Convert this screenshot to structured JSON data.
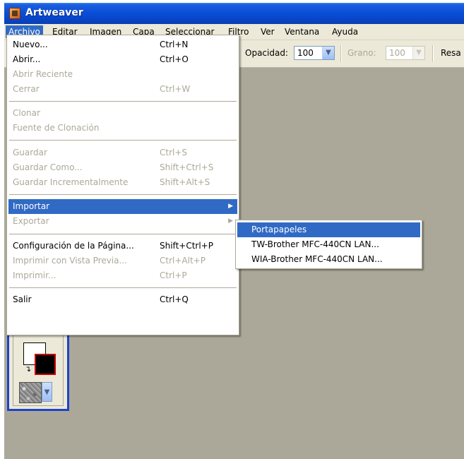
{
  "window": {
    "title": "Artweaver"
  },
  "menubar": [
    {
      "label": "Archivo",
      "active": true
    },
    {
      "label": "Editar"
    },
    {
      "label": "Imagen"
    },
    {
      "label": "Capa"
    },
    {
      "label": "Seleccionar"
    },
    {
      "label": "Filtro"
    },
    {
      "label": "Ver"
    },
    {
      "label": "Ventana"
    },
    {
      "label": "Ayuda"
    }
  ],
  "toolbar": {
    "opacity_label": "Opacidad:",
    "opacity_value": "100",
    "grain_label": "Grano:",
    "grain_value": "100",
    "resa_label": "Resa"
  },
  "archivo_menu": [
    {
      "label": "Nuevo...",
      "shortcut": "Ctrl+N",
      "enabled": true
    },
    {
      "label": "Abrir...",
      "shortcut": "Ctrl+O",
      "enabled": true
    },
    {
      "label": "Abrir Reciente",
      "shortcut": "",
      "enabled": false
    },
    {
      "label": "Cerrar",
      "shortcut": "Ctrl+W",
      "enabled": false
    },
    {
      "label": "Clonar",
      "shortcut": "",
      "enabled": false
    },
    {
      "label": "Fuente de Clonación",
      "shortcut": "",
      "enabled": false
    },
    {
      "label": "Guardar",
      "shortcut": "Ctrl+S",
      "enabled": false
    },
    {
      "label": "Guardar Como...",
      "shortcut": "Shift+Ctrl+S",
      "enabled": false
    },
    {
      "label": "Guardar Incrementalmente",
      "shortcut": "Shift+Alt+S",
      "enabled": false
    },
    {
      "label": "Importar",
      "shortcut": "",
      "enabled": true,
      "submenu": true,
      "highlighted": true
    },
    {
      "label": "Exportar",
      "shortcut": "",
      "enabled": false,
      "submenu": true
    },
    {
      "label": "Configuración de la Página...",
      "shortcut": "Shift+Ctrl+P",
      "enabled": true
    },
    {
      "label": "Imprimir con Vista Previa...",
      "shortcut": "Ctrl+Alt+P",
      "enabled": false
    },
    {
      "label": "Imprimir...",
      "shortcut": "Ctrl+P",
      "enabled": false
    },
    {
      "label": "Salir",
      "shortcut": "Ctrl+Q",
      "enabled": true
    }
  ],
  "importar_submenu": [
    {
      "label": "Portapapeles",
      "highlighted": true
    },
    {
      "label": "TW-Brother MFC-440CN LAN..."
    },
    {
      "label": "WIA-Brother MFC-440CN LAN..."
    }
  ],
  "tool_panel": {
    "swap_icon": "swap-colors-icon"
  },
  "colors": {
    "menu_highlight": "#316ac5",
    "workspace": "#aca899",
    "foreground": "#000000",
    "background": "#ffffff"
  }
}
